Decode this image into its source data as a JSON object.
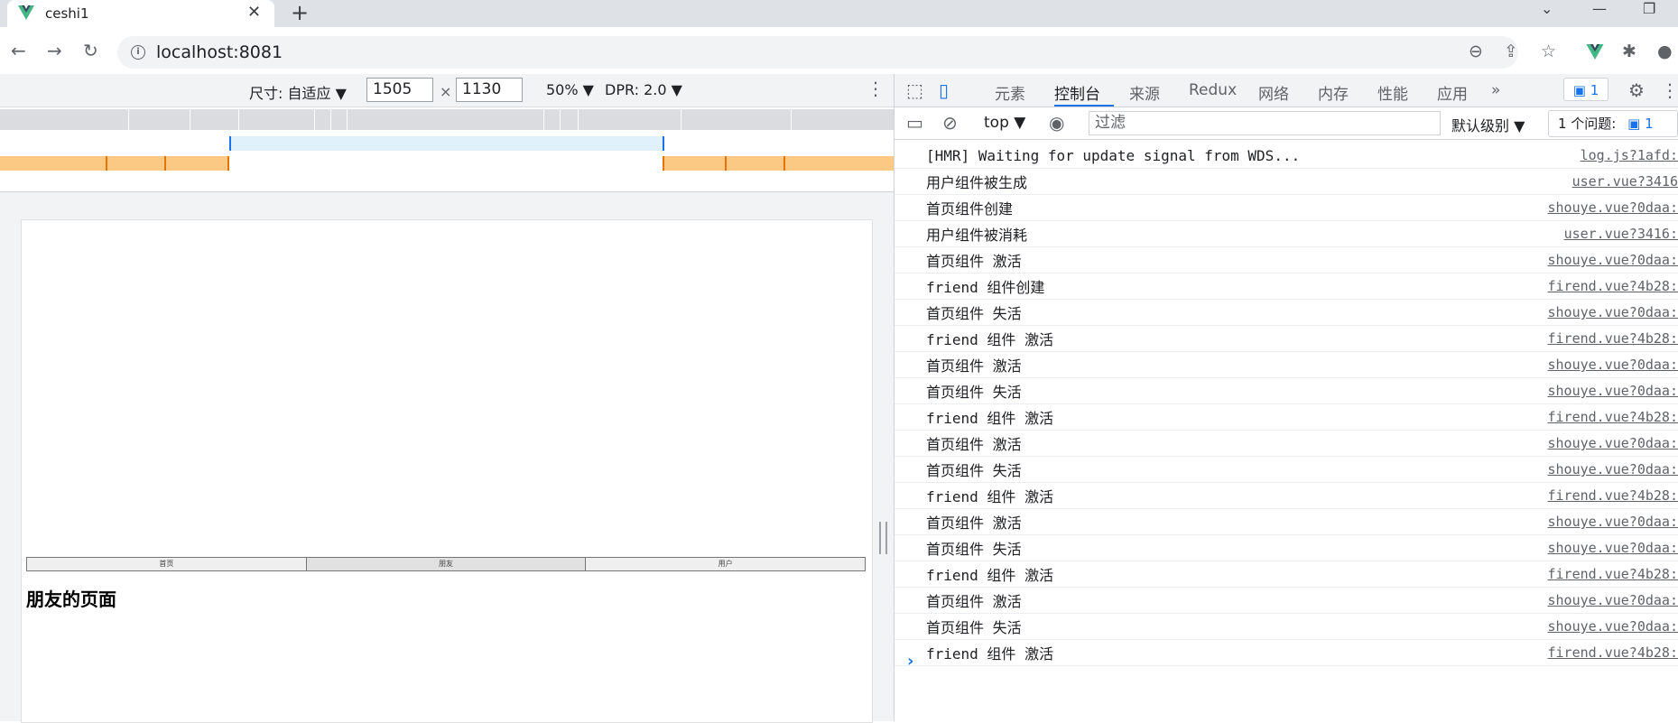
{
  "browser": {
    "tab_title": "ceshi1",
    "new_tab": "+",
    "url": "localhost:8081"
  },
  "device_toolbar": {
    "dimensions_label": "尺寸: 自适应 ▼",
    "width": "1505",
    "height": "1130",
    "times": "×",
    "zoom": "50% ▼",
    "dpr": "DPR: 2.0 ▼"
  },
  "page": {
    "nav_items": [
      "首页",
      "朋友",
      "用户"
    ],
    "heading": "朋友的页面"
  },
  "devtools": {
    "tabs": [
      "元素",
      "控制台",
      "来源",
      "Redux",
      "网络",
      "内存",
      "性能",
      "应用"
    ],
    "active_tab": "控制台",
    "more": "»",
    "issues_badge": "1",
    "context": "top ▼",
    "filter_placeholder": "过滤",
    "levels": "默认级别 ▼",
    "issues_count": "1 个问题:",
    "issues_count_num": "1",
    "log": [
      {
        "msg": "[HMR] Waiting for update signal from WDS...",
        "src": "log.js?1afd:"
      },
      {
        "msg": "用户组件被生成",
        "src": "user.vue?3416"
      },
      {
        "msg": "首页组件创建",
        "src": "shouye.vue?0daa:"
      },
      {
        "msg": "用户组件被消耗",
        "src": "user.vue?3416:"
      },
      {
        "msg": "首页组件 激活",
        "src": "shouye.vue?0daa:"
      },
      {
        "msg": "friend 组件创建",
        "src": "firend.vue?4b28:"
      },
      {
        "msg": "首页组件 失活",
        "src": "shouye.vue?0daa:"
      },
      {
        "msg": "friend 组件 激活",
        "src": "firend.vue?4b28:"
      },
      {
        "msg": "首页组件 激活",
        "src": "shouye.vue?0daa:"
      },
      {
        "msg": "首页组件 失活",
        "src": "shouye.vue?0daa:"
      },
      {
        "msg": "friend 组件 激活",
        "src": "firend.vue?4b28:"
      },
      {
        "msg": "首页组件 激活",
        "src": "shouye.vue?0daa:"
      },
      {
        "msg": "首页组件 失活",
        "src": "shouye.vue?0daa:"
      },
      {
        "msg": "friend 组件 激活",
        "src": "firend.vue?4b28:"
      },
      {
        "msg": "首页组件 激活",
        "src": "shouye.vue?0daa:"
      },
      {
        "msg": "首页组件 失活",
        "src": "shouye.vue?0daa:"
      },
      {
        "msg": "friend 组件 激活",
        "src": "firend.vue?4b28:"
      },
      {
        "msg": "首页组件 激活",
        "src": "shouye.vue?0daa:"
      },
      {
        "msg": "首页组件 失活",
        "src": "shouye.vue?0daa:"
      },
      {
        "msg": "friend 组件 激活",
        "src": "firend.vue?4b28:"
      }
    ]
  }
}
